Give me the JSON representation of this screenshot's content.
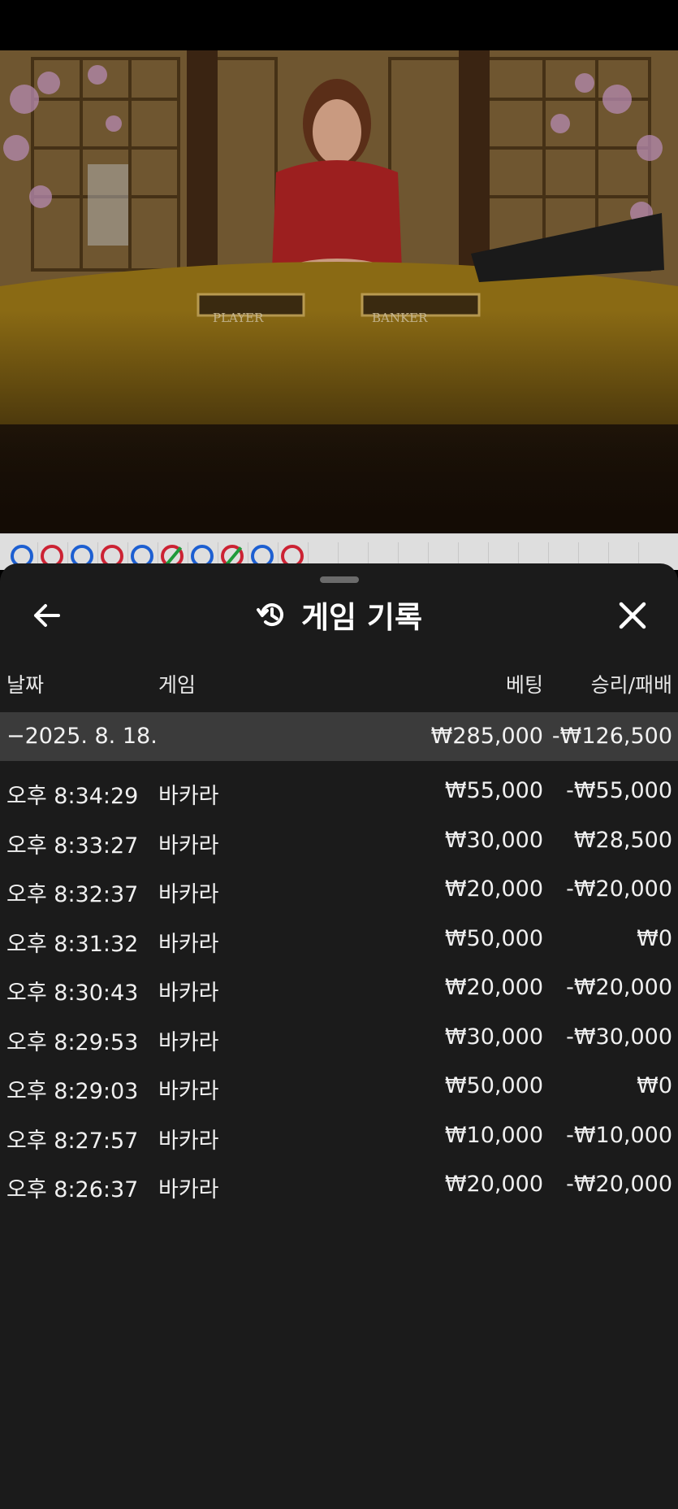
{
  "header": {
    "title": "게임 기록"
  },
  "columns": {
    "date": "날짜",
    "game": "게임",
    "bet": "베팅",
    "result": "승리/패배"
  },
  "summary": {
    "date": "−2025. 8. 18.",
    "bet": "₩285,000",
    "result": "-₩126,500"
  },
  "rows": [
    {
      "time": "오후 8:34:29",
      "game": "바카라",
      "bet": "₩55,000",
      "result": "-₩55,000"
    },
    {
      "time": "오후 8:33:27",
      "game": "바카라",
      "bet": "₩30,000",
      "result": "₩28,500"
    },
    {
      "time": "오후 8:32:37",
      "game": "바카라",
      "bet": "₩20,000",
      "result": "-₩20,000"
    },
    {
      "time": "오후 8:31:32",
      "game": "바카라",
      "bet": "₩50,000",
      "result": "₩0"
    },
    {
      "time": "오후 8:30:43",
      "game": "바카라",
      "bet": "₩20,000",
      "result": "-₩20,000"
    },
    {
      "time": "오후 8:29:53",
      "game": "바카라",
      "bet": "₩30,000",
      "result": "-₩30,000"
    },
    {
      "time": "오후 8:29:03",
      "game": "바카라",
      "bet": "₩50,000",
      "result": "₩0"
    },
    {
      "time": "오후 8:27:57",
      "game": "바카라",
      "bet": "₩10,000",
      "result": "-₩10,000"
    },
    {
      "time": "오후 8:26:37",
      "game": "바카라",
      "bet": "₩20,000",
      "result": "-₩20,000"
    }
  ],
  "table_labels": {
    "player": "PLAYER",
    "banker": "BANKER"
  },
  "road": [
    "blue",
    "red",
    "blue",
    "red",
    "blue",
    "red-tie",
    "blue",
    "red-tie",
    "blue",
    "red"
  ],
  "icons": {
    "back": "arrow-left-icon",
    "history": "history-icon",
    "close": "close-icon"
  }
}
